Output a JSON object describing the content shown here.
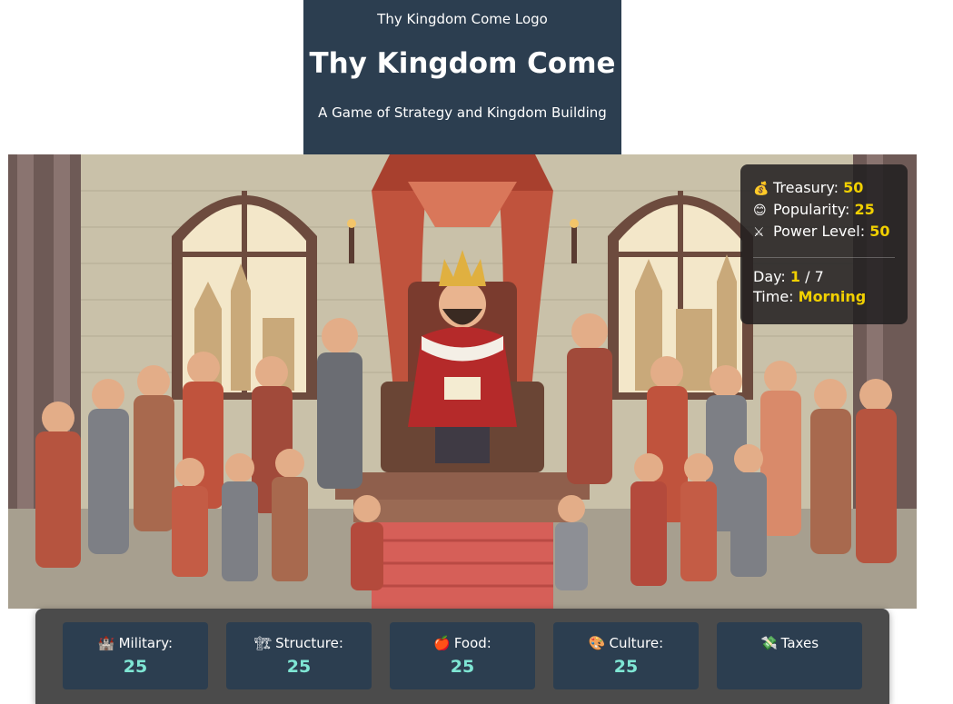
{
  "header": {
    "logo_text": "Thy Kingdom Come Logo",
    "title": "Thy Kingdom Come",
    "subtitle": "A Game of Strategy and Kingdom Building"
  },
  "stats": {
    "treasury": {
      "icon": "money-bag-icon",
      "label": "Treasury:",
      "value": "50"
    },
    "popularity": {
      "icon": "smiley-icon",
      "label": "Popularity:",
      "value": "25"
    },
    "power": {
      "icon": "crossed-swords-icon",
      "label": "Power Level:",
      "value": "50"
    },
    "day": {
      "label": "Day:",
      "current": "1",
      "separator": "/",
      "total": "7"
    },
    "time": {
      "label": "Time:",
      "value": "Morning"
    }
  },
  "actions": [
    {
      "icon": "castle-icon",
      "glyph": "🏰",
      "label": "Military:",
      "value": "25"
    },
    {
      "icon": "construction-icon",
      "glyph": "🏗",
      "label": "Structure:",
      "value": "25"
    },
    {
      "icon": "apple-icon",
      "glyph": "🍎",
      "label": "Food:",
      "value": "25"
    },
    {
      "icon": "palette-icon",
      "glyph": "🎨",
      "label": "Culture:",
      "value": "25"
    },
    {
      "icon": "money-wings-icon",
      "glyph": "💸",
      "label": "Taxes",
      "value": ""
    }
  ],
  "colors": {
    "header_bg": "#2c3e50",
    "accent_value": "#f1d000",
    "card_value": "#7fe6d4",
    "bar_bg": "#4b4b4b"
  }
}
